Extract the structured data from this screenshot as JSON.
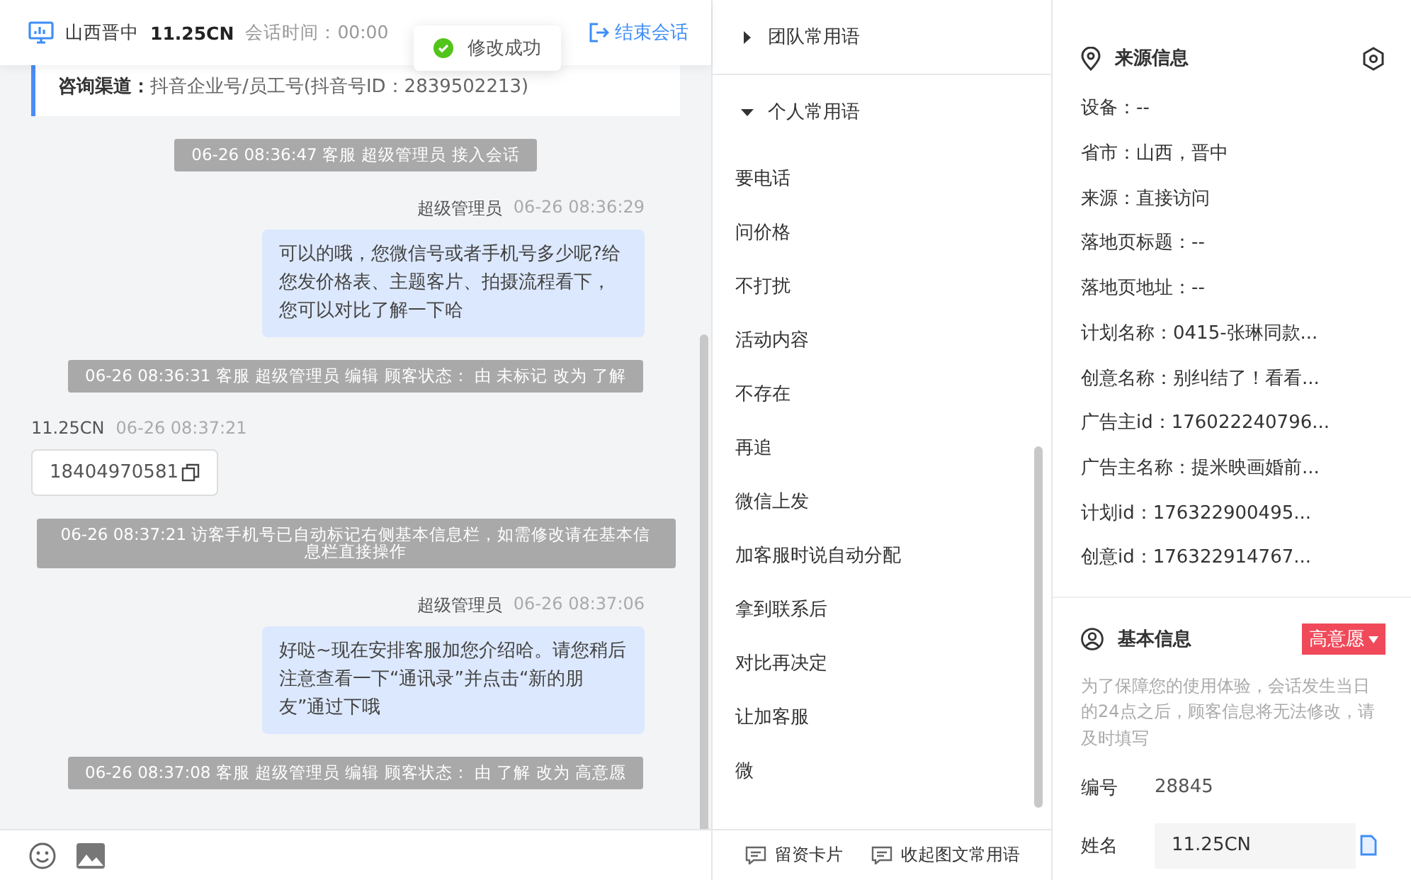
{
  "header": {
    "location": "山西晋中",
    "customer": "11.25CN",
    "session_time": "会话时间：00:00",
    "end_button": "结束会话"
  },
  "toast": {
    "text": "修改成功"
  },
  "channel": {
    "label": "咨询渠道：",
    "value": "抖音企业号/员工号(抖音号ID：2839502213)"
  },
  "messages": [
    {
      "kind": "system",
      "text": "06-26 08:36:47 客服 超级管理员 接入会话"
    },
    {
      "kind": "agent",
      "sender": "超级管理员",
      "time": "06-26 08:36:29",
      "text": "可以的哦，您微信号或者手机号多少呢?给您发价格表、主题客片、拍摄流程看下，您可以对比了解一下哈"
    },
    {
      "kind": "system",
      "text": "06-26 08:36:31 客服 超级管理员 编辑 顾客状态： 由 未标记 改为 了解"
    },
    {
      "kind": "visitor",
      "sender": "11.25CN",
      "time": "06-26 08:37:21",
      "text": "18404970581"
    },
    {
      "kind": "system",
      "text": "06-26 08:37:21 访客手机号已自动标记右侧基本信息栏，如需修改请在基本信息栏直接操作"
    },
    {
      "kind": "agent",
      "sender": "超级管理员",
      "time": "06-26 08:37:06",
      "text": "好哒~现在安排客服加您介绍哈。请您稍后注意查看一下“通讯录”并点击“新的朋友”通过下哦"
    },
    {
      "kind": "system",
      "text": "06-26 08:37:08 客服 超级管理员 编辑 顾客状态： 由 了解 改为 高意愿"
    }
  ],
  "phrases": {
    "groups": [
      {
        "title": "团队常用语",
        "expanded": false
      },
      {
        "title": "个人常用语",
        "expanded": true
      }
    ],
    "items": [
      "要电话",
      "问价格",
      "不打扰",
      "活动内容",
      "不存在",
      "再追",
      "微信上发",
      "加客服时说自动分配",
      "拿到联系后",
      "对比再决定",
      "让加客服",
      "微"
    ]
  },
  "footer": {
    "buttons": [
      "留资卡片",
      "收起图文常用语"
    ]
  },
  "source": {
    "title": "来源信息",
    "rows": [
      "设备：--",
      "省市：山西，晋中",
      "来源：直接访问",
      "落地页标题：--",
      "落地页地址：--",
      "计划名称：0415-张琳同款...",
      "创意名称：别纠结了！看看...",
      "广告主id：176022240796...",
      "广告主名称：提米映画婚前...",
      "计划id：176322900495...",
      "创意id：176322914767..."
    ]
  },
  "basic": {
    "title": "基本信息",
    "intent": "高意愿",
    "note": "为了保障您的使用体验，会话发生当日的24点之后，顾客信息将无法修改，请及时填写",
    "fields": [
      {
        "kind": "text",
        "label": "编号",
        "value": "28845"
      },
      {
        "kind": "input",
        "label": "姓名",
        "value": "11.25CN"
      }
    ]
  }
}
